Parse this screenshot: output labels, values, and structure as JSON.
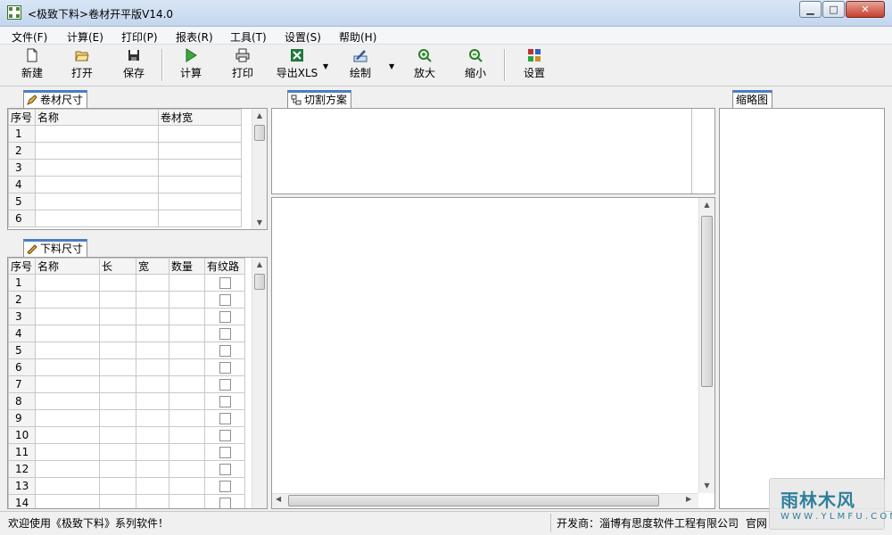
{
  "window": {
    "title": "<极致下料>卷材开平版V14.0"
  },
  "menu": [
    {
      "label": "文件(F)"
    },
    {
      "label": "计算(E)"
    },
    {
      "label": "打印(P)"
    },
    {
      "label": "报表(R)"
    },
    {
      "label": "工具(T)"
    },
    {
      "label": "设置(S)"
    },
    {
      "label": "帮助(H)"
    }
  ],
  "toolbar": {
    "new": "新建",
    "open": "打开",
    "save": "保存",
    "calc": "计算",
    "print": "打印",
    "export": "导出XLS",
    "draw": "绘制",
    "zoom_in": "放大",
    "zoom_out": "缩小",
    "settings": "设置"
  },
  "roll_panel": {
    "tab": "卷材尺寸",
    "columns": [
      "序号",
      "名称",
      "卷材宽"
    ],
    "rows": [
      "1",
      "2",
      "3",
      "4",
      "5",
      "6"
    ]
  },
  "cut_panel": {
    "tab": "下料尺寸",
    "columns": [
      "序号",
      "名称",
      "长",
      "宽",
      "数量",
      "有纹路"
    ],
    "rows": [
      "1",
      "2",
      "3",
      "4",
      "5",
      "6",
      "7",
      "8",
      "9",
      "10",
      "11",
      "12",
      "13",
      "14"
    ]
  },
  "plan_panel": {
    "tab": "切割方案"
  },
  "thumb_panel": {
    "tab": "缩略图"
  },
  "status": {
    "welcome": "欢迎使用《极致下料》系列软件！",
    "developer": "开发商：淄博有思度软件工程有限公司",
    "site": "官网"
  },
  "watermark": {
    "main": "雨林木风",
    "url": "W W W . Y L M F U . C O M"
  },
  "colors": {
    "tab_accent": "#4b7dc0",
    "title_bar": "#c3d6ee"
  }
}
